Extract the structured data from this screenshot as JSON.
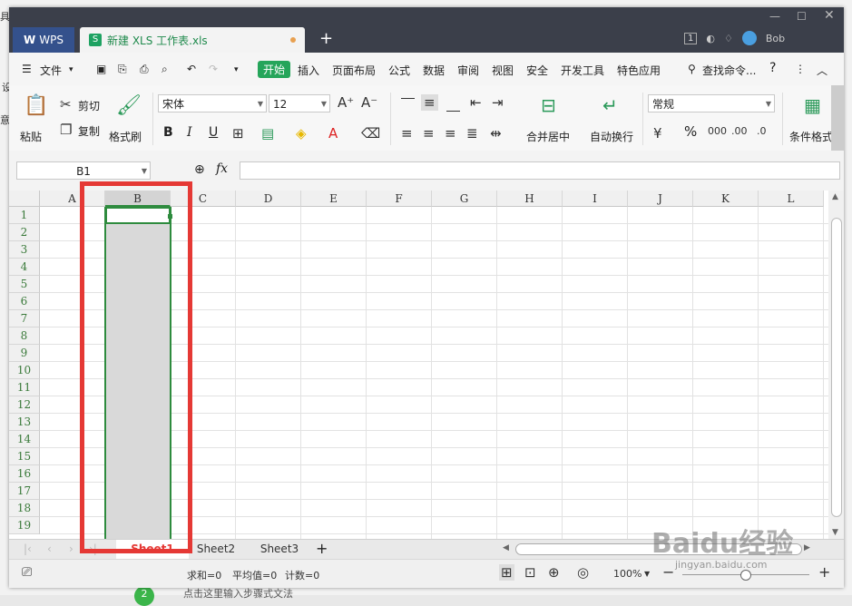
{
  "titlebar": {
    "app_tab": "WPS",
    "doc_tab": "新建 XLS 工作表.xls",
    "doc_icon": "S",
    "sheet_count": "1",
    "user": "Bob",
    "new_tab": "+"
  },
  "menu": {
    "file": "文件",
    "items": [
      "开始",
      "插入",
      "页面布局",
      "公式",
      "数据",
      "审阅",
      "视图",
      "安全",
      "开发工具",
      "特色应用"
    ],
    "search": "查找命令...",
    "help": "?"
  },
  "ribbon": {
    "paste": "粘贴",
    "cut": "剪切",
    "copy": "复制",
    "format_painter": "格式刷",
    "font_name": "宋体",
    "font_size": "12",
    "bold": "B",
    "italic": "I",
    "underline": "U",
    "merge_center": "合并居中",
    "wrap_text": "自动换行",
    "number_format": "常规",
    "percent": "%",
    "cond_format": "条件格式"
  },
  "formula_bar": {
    "name_box": "B1",
    "fx": "fx",
    "value": ""
  },
  "columns": [
    "A",
    "B",
    "C",
    "D",
    "E",
    "F",
    "G",
    "H",
    "I",
    "J",
    "K",
    "L"
  ],
  "rows": [
    "1",
    "2",
    "3",
    "4",
    "5",
    "6",
    "7",
    "8",
    "9",
    "10",
    "11",
    "12",
    "13",
    "14",
    "15",
    "16",
    "17",
    "18",
    "19"
  ],
  "sheets": [
    "Sheet1",
    "Sheet2",
    "Sheet3"
  ],
  "status": {
    "sum": "求和=0",
    "avg": "平均值=0",
    "count": "计数=0",
    "zoom": "100%"
  },
  "background_page": {
    "left_fragments": [
      "具",
      "设",
      "意"
    ],
    "bottom_step": "2",
    "bottom_text": "点击这里输入步骤式文法"
  },
  "watermark": {
    "brand": "Baidu经验",
    "url": "jingyan.baidu.com"
  },
  "colors": {
    "title_bg": "#3b3f4a",
    "accent_green": "#25a55a",
    "selection_green": "#2e8b3e",
    "highlight_red": "#e53935"
  }
}
